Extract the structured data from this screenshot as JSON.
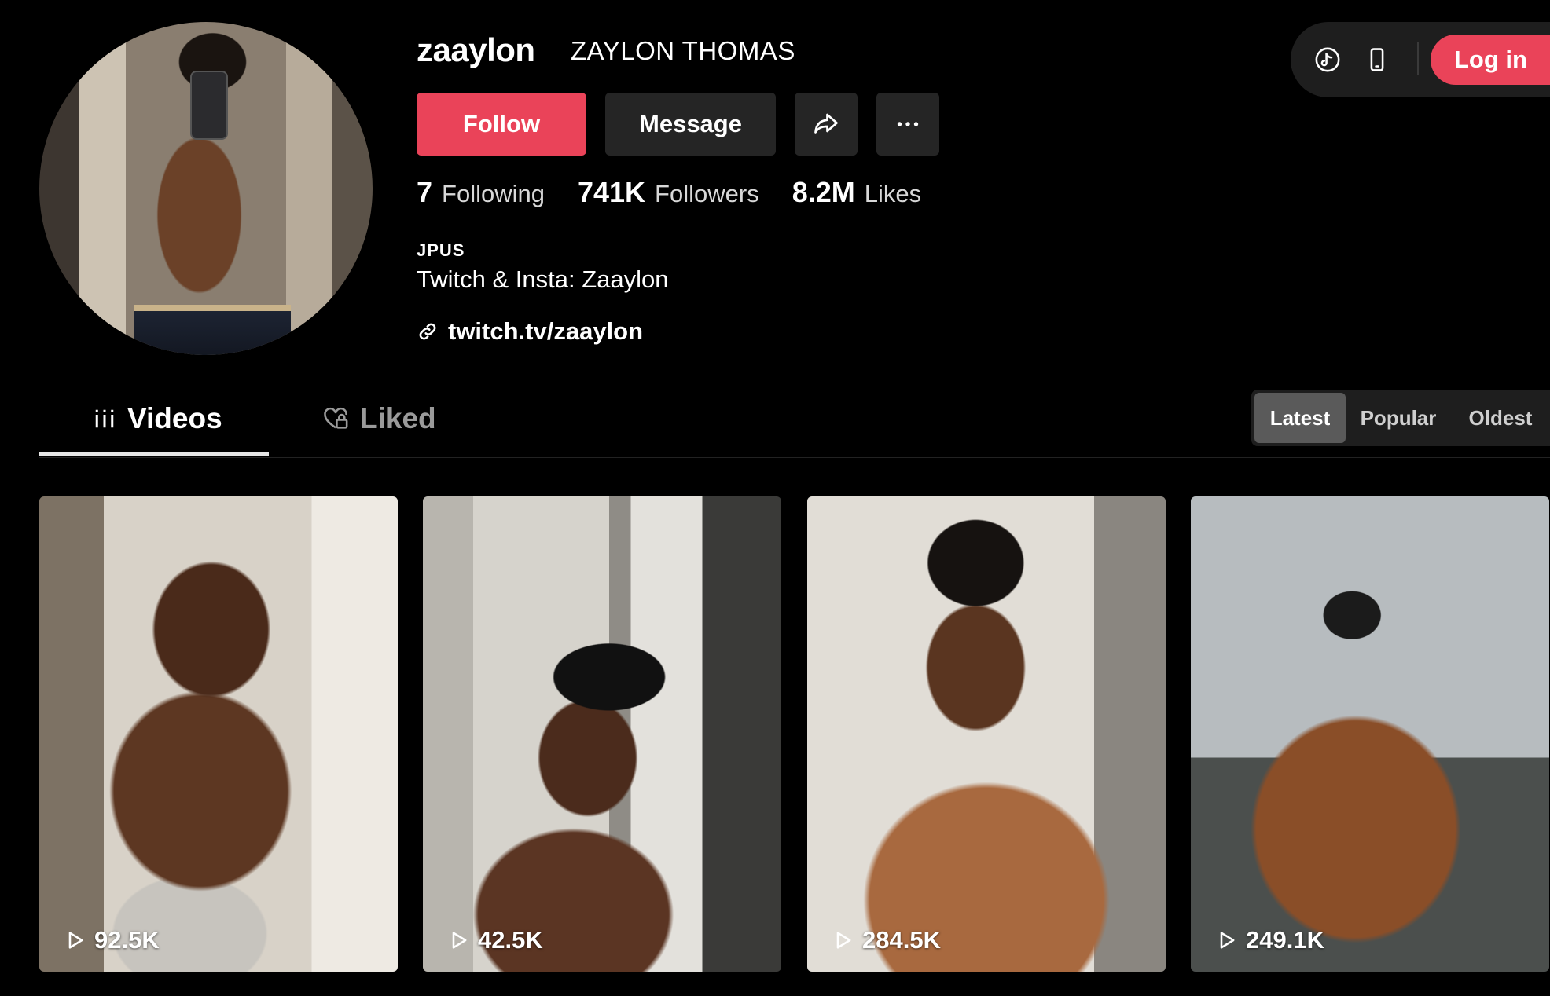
{
  "profile": {
    "username": "zaaylon",
    "nickname": "ZAYLON THOMAS",
    "follow_label": "Follow",
    "message_label": "Message",
    "share_icon": "share-icon",
    "more_icon": "more-icon"
  },
  "stats": [
    {
      "value": "7",
      "label": "Following"
    },
    {
      "value": "741K",
      "label": "Followers"
    },
    {
      "value": "8.2M",
      "label": "Likes"
    }
  ],
  "bio": {
    "tag": "JPUS",
    "text": "Twitch & Insta: Zaaylon",
    "link": "twitch.tv/zaaylon"
  },
  "top_bar": {
    "login_label": "Log in"
  },
  "tabs": [
    {
      "label": "Videos",
      "active": true
    },
    {
      "label": "Liked",
      "active": false
    }
  ],
  "sort": [
    {
      "label": "Latest",
      "active": true
    },
    {
      "label": "Popular",
      "active": false
    },
    {
      "label": "Oldest",
      "active": false
    }
  ],
  "videos": [
    {
      "views": "92.5K"
    },
    {
      "views": "42.5K"
    },
    {
      "views": "284.5K"
    },
    {
      "views": "249.1K"
    }
  ],
  "colors": {
    "accent": "#ea4359",
    "background": "#000000",
    "button_dark": "#252525"
  }
}
